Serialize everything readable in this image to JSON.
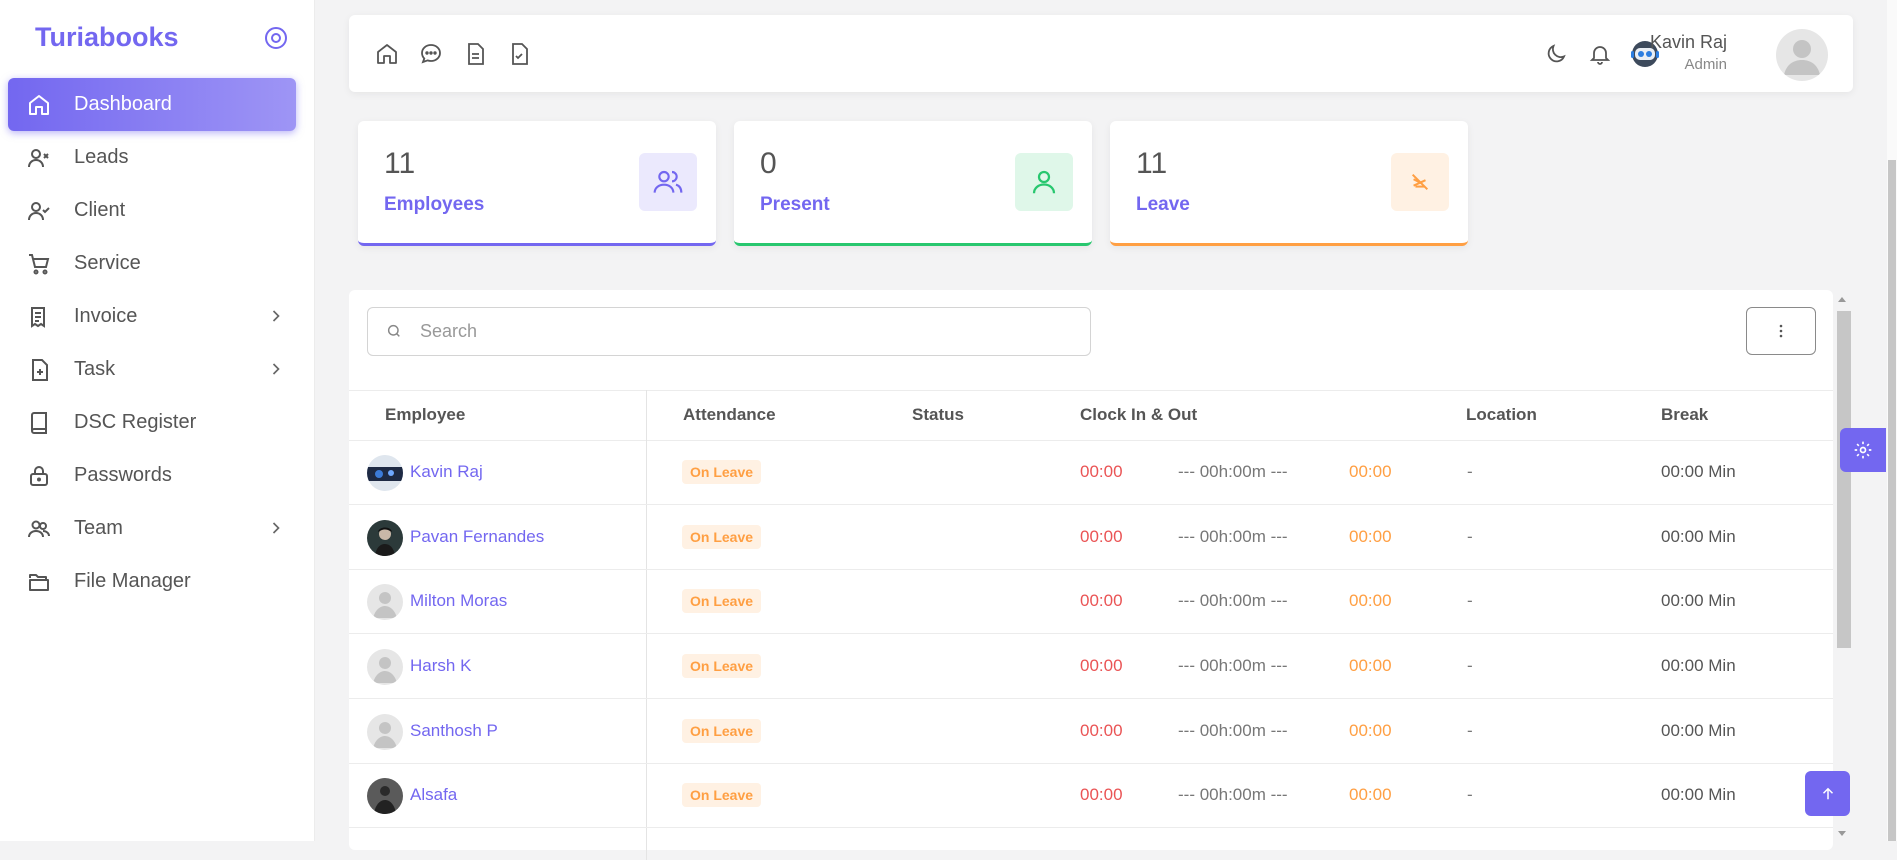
{
  "sidebar": {
    "brand": "Turiabooks",
    "items": [
      {
        "label": "Dashboard"
      },
      {
        "label": "Leads"
      },
      {
        "label": "Client"
      },
      {
        "label": "Service"
      },
      {
        "label": "Invoice"
      },
      {
        "label": "Task"
      },
      {
        "label": "DSC Register"
      },
      {
        "label": "Passwords"
      },
      {
        "label": "Team"
      },
      {
        "label": "File Manager"
      }
    ]
  },
  "topbar": {
    "user_name": "Kavin Raj",
    "user_role": "Admin"
  },
  "stats": [
    {
      "value": "11",
      "label": "Employees",
      "color": "#7367f0"
    },
    {
      "value": "0",
      "label": "Present",
      "color": "#28c76f"
    },
    {
      "value": "11",
      "label": "Leave",
      "color": "#ff9f43"
    }
  ],
  "table": {
    "search_placeholder": "Search",
    "columns": [
      "Employee",
      "Attendance",
      "Status",
      "Clock In & Out",
      "Location",
      "Break"
    ],
    "rows": [
      {
        "name": "Kavin Raj",
        "attendance": "On Leave",
        "clock_in": "00:00",
        "duration": "--- 00h:00m ---",
        "clock_out": "00:00",
        "location": "-",
        "break": "00:00 Min"
      },
      {
        "name": "Pavan Fernandes",
        "attendance": "On Leave",
        "clock_in": "00:00",
        "duration": "--- 00h:00m ---",
        "clock_out": "00:00",
        "location": "-",
        "break": "00:00 Min"
      },
      {
        "name": "Milton Moras",
        "attendance": "On Leave",
        "clock_in": "00:00",
        "duration": "--- 00h:00m ---",
        "clock_out": "00:00",
        "location": "-",
        "break": "00:00 Min"
      },
      {
        "name": "Harsh K",
        "attendance": "On Leave",
        "clock_in": "00:00",
        "duration": "--- 00h:00m ---",
        "clock_out": "00:00",
        "location": "-",
        "break": "00:00 Min"
      },
      {
        "name": "Santhosh P",
        "attendance": "On Leave",
        "clock_in": "00:00",
        "duration": "--- 00h:00m ---",
        "clock_out": "00:00",
        "location": "-",
        "break": "00:00 Min"
      },
      {
        "name": "Alsafa",
        "attendance": "On Leave",
        "clock_in": "00:00",
        "duration": "--- 00h:00m ---",
        "clock_out": "00:00",
        "location": "-",
        "break": "00:00 Min"
      }
    ]
  },
  "theme": {
    "accent": "#7367f0",
    "success": "#28c76f",
    "warning": "#ff9f43",
    "danger": "#ea5455"
  }
}
